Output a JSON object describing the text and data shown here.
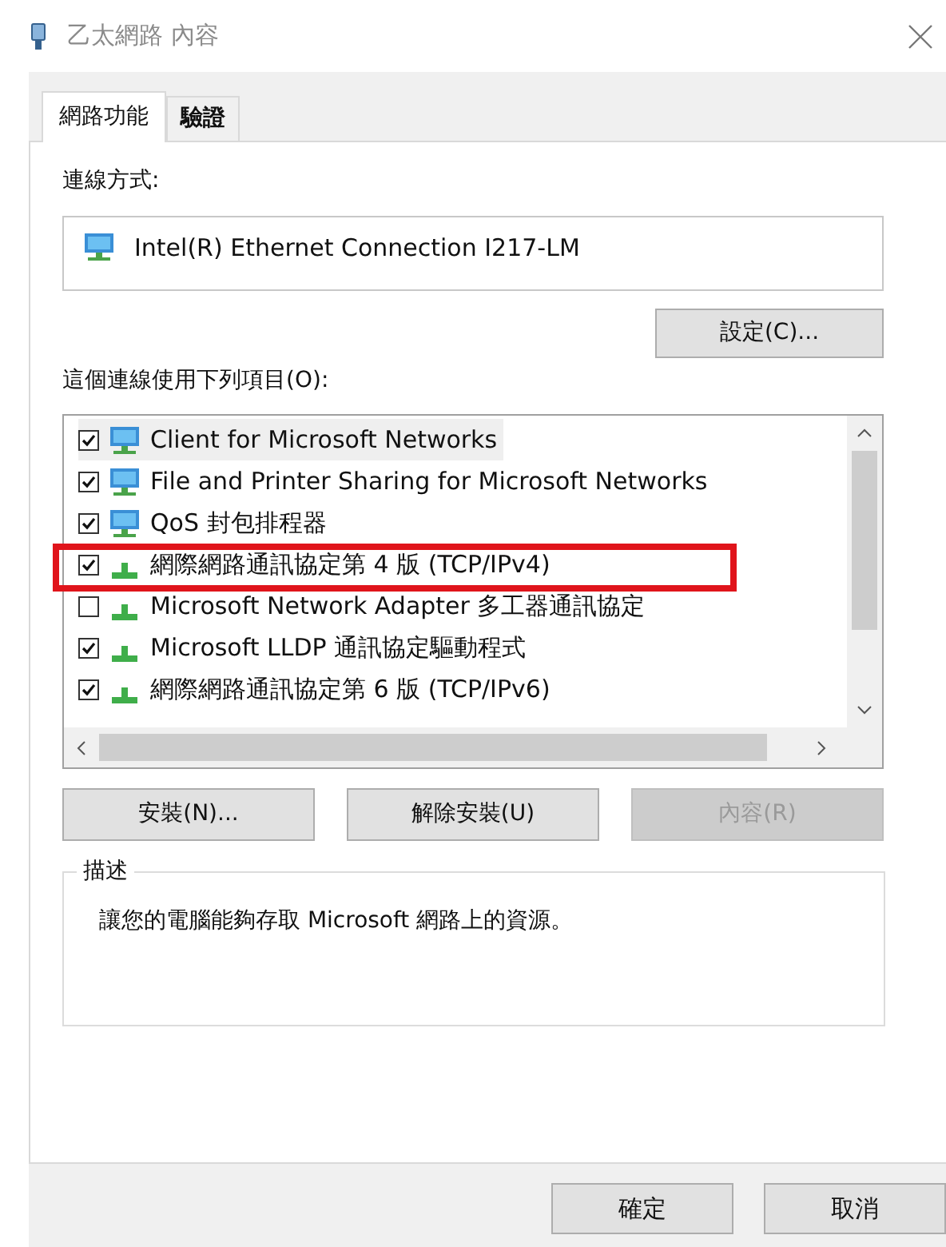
{
  "window": {
    "title": "乙太網路 內容"
  },
  "tabs": [
    {
      "label": "網路功能",
      "selected": true
    },
    {
      "label": "驗證",
      "selected": false
    }
  ],
  "connect_using": {
    "label": "連線方式:",
    "adapter": "Intel(R) Ethernet Connection I217-LM",
    "configure_button": "設定(C)..."
  },
  "items": {
    "label": "這個連線使用下列項目(O):",
    "list": [
      {
        "name": "Client for Microsoft Networks",
        "checked": true,
        "selected": true,
        "kind": "computer"
      },
      {
        "name": "File and Printer Sharing for Microsoft Networks",
        "checked": true,
        "selected": false,
        "kind": "computer"
      },
      {
        "name": "QoS 封包排程器",
        "checked": true,
        "selected": false,
        "kind": "computer"
      },
      {
        "name": "網際網路通訊協定第 4 版 (TCP/IPv4)",
        "checked": true,
        "selected": false,
        "kind": "protocol"
      },
      {
        "name": "Microsoft Network Adapter 多工器通訊協定",
        "checked": false,
        "selected": false,
        "kind": "protocol"
      },
      {
        "name": "Microsoft LLDP 通訊協定驅動程式",
        "checked": true,
        "selected": false,
        "kind": "protocol"
      },
      {
        "name": "網際網路通訊協定第 6 版 (TCP/IPv6)",
        "checked": true,
        "selected": false,
        "kind": "protocol"
      }
    ]
  },
  "item_buttons": [
    {
      "label": "安裝(N)...",
      "disabled": false
    },
    {
      "label": "解除安裝(U)",
      "disabled": false
    },
    {
      "label": "內容(R)",
      "disabled": true
    }
  ],
  "description": {
    "legend": "描述",
    "text": "讓您的電腦能夠存取 Microsoft 網路上的資源。"
  },
  "dialog_buttons": [
    "確定",
    "取消"
  ]
}
